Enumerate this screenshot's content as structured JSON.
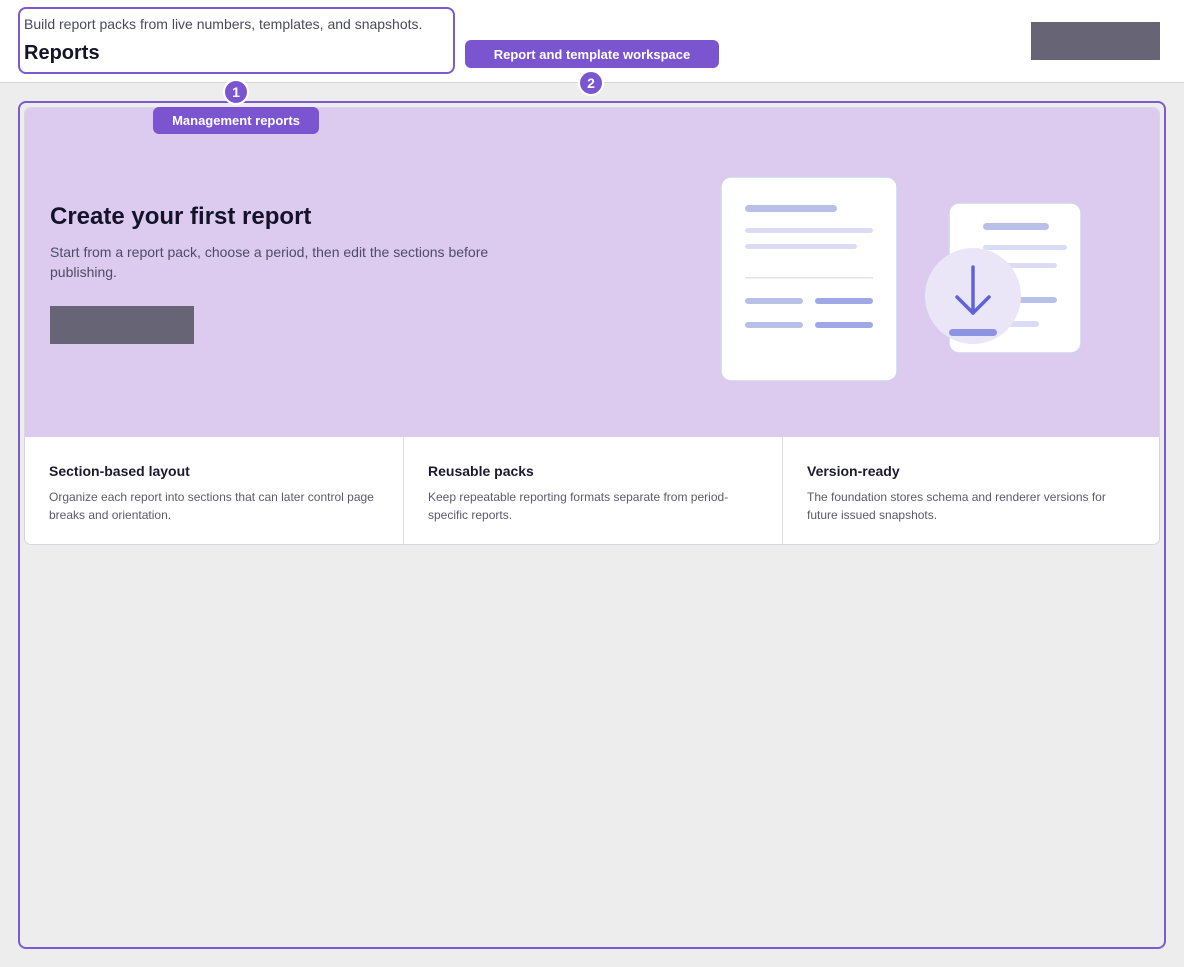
{
  "header": {
    "subtitle": "Build report packs from live numbers, templates, and snapshots.",
    "title": "Reports",
    "workspace_label": "Report and template workspace",
    "badge_1": "1",
    "badge_2": "2"
  },
  "section": {
    "label": "Management reports"
  },
  "hero": {
    "title": "Create your first report",
    "description": "Start from a report pack, choose a period, then edit the sections before publishing.",
    "illustration_icons": [
      "document-icon",
      "download-icon"
    ]
  },
  "features": [
    {
      "title": "Section-based layout",
      "description": "Organize each report into sections that can later control page breaks and orientation."
    },
    {
      "title": "Reusable packs",
      "description": "Keep repeatable reporting formats separate from period-specific reports."
    },
    {
      "title": "Version-ready",
      "description": "The foundation stores schema and renderer versions for future issued snapshots."
    }
  ],
  "colors": {
    "accent": "#7b55cf",
    "hero_background": "#dccbef",
    "placeholder_button": "#676575",
    "page_background": "#ededed"
  }
}
